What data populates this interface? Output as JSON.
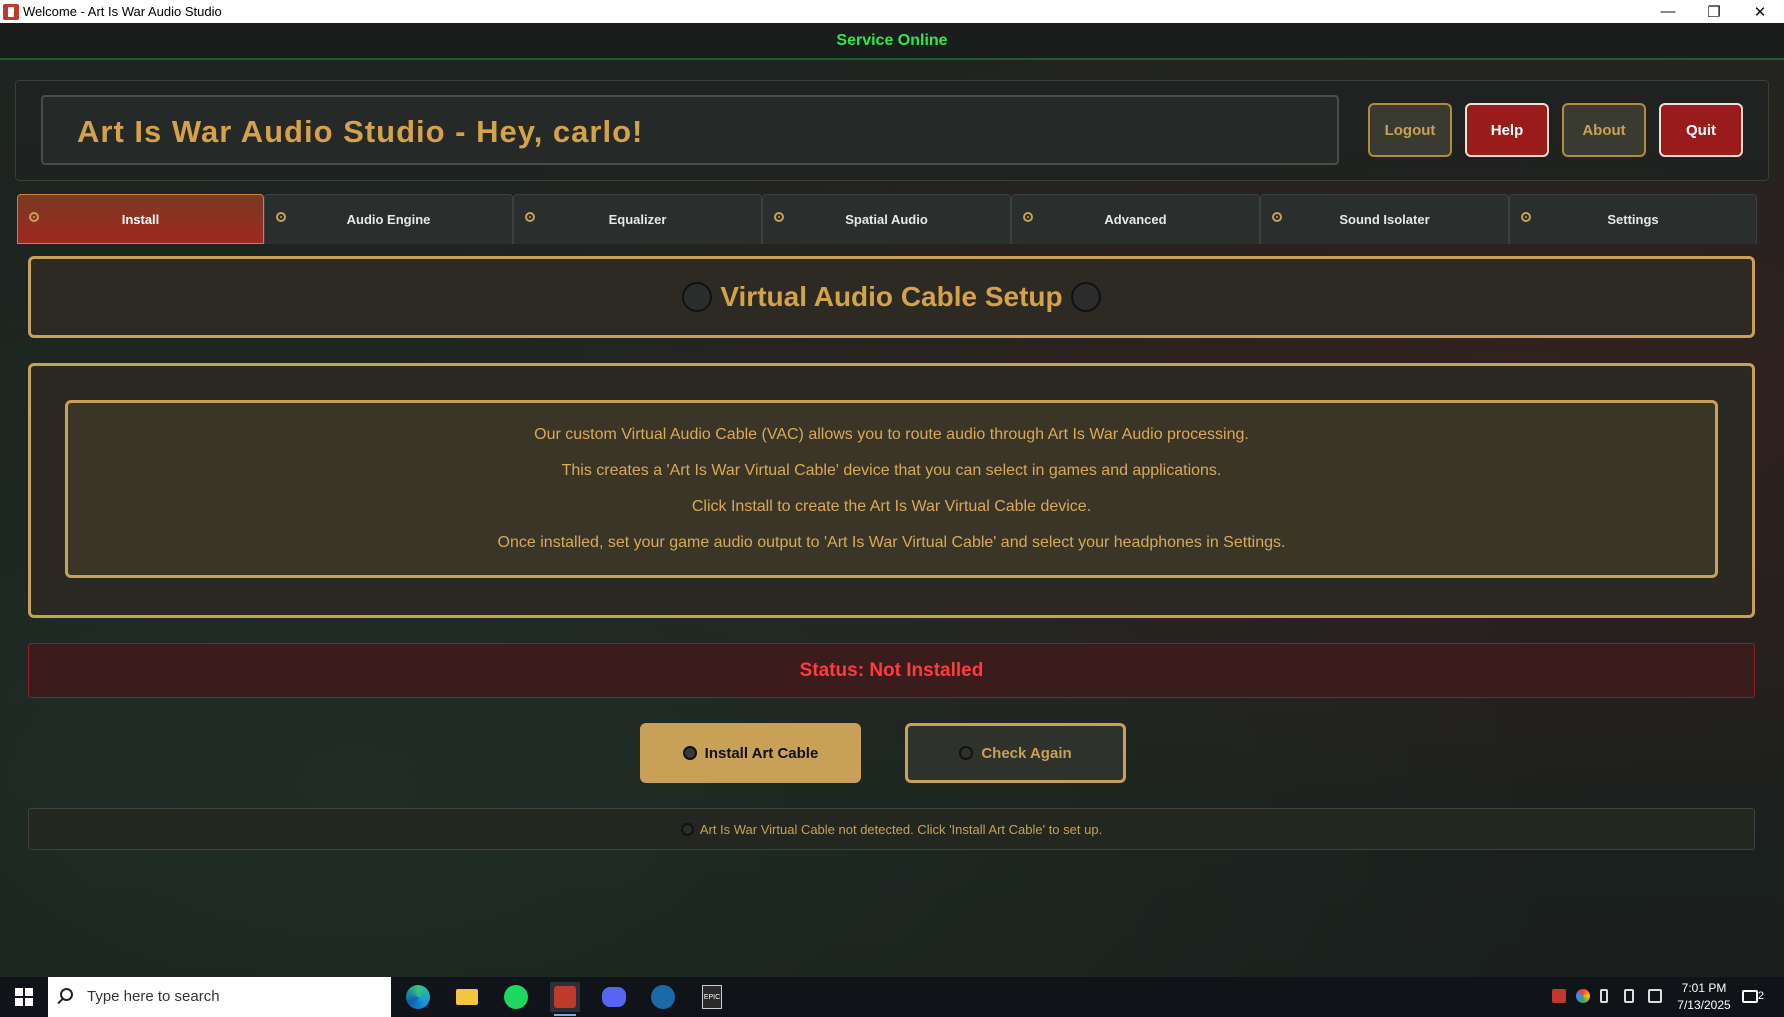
{
  "window": {
    "title": "Welcome - Art Is War Audio Studio",
    "minimize": "—",
    "maximize": "❐",
    "close": "✕"
  },
  "service_status": "Service Online",
  "header": {
    "title": "Art Is War Audio Studio - Hey, carlo!",
    "buttons": {
      "logout": "Logout",
      "help": "Help",
      "about": "About",
      "quit": "Quit"
    }
  },
  "tabs": [
    {
      "label": "Install",
      "active": true
    },
    {
      "label": "Audio Engine",
      "active": false
    },
    {
      "label": "Equalizer",
      "active": false
    },
    {
      "label": "Spatial Audio",
      "active": false
    },
    {
      "label": "Advanced",
      "active": false
    },
    {
      "label": "Sound Isolater",
      "active": false
    },
    {
      "label": "Settings",
      "active": false
    }
  ],
  "section": {
    "title": "Virtual Audio Cable Setup"
  },
  "info_lines": [
    "Our custom Virtual Audio Cable (VAC) allows you to route audio through Art Is War Audio processing.",
    "This creates a 'Art Is War Virtual Cable' device that you can select in games and applications.",
    "Click Install to create the Art Is War Virtual Cable device.",
    "Once installed, set your game audio output to 'Art Is War Virtual Cable' and select your headphones in Settings."
  ],
  "status": "Status: Not Installed",
  "actions": {
    "install": "Install Art Cable",
    "check": "Check Again"
  },
  "note": "Art Is War Virtual Cable not detected. Click 'Install Art Cable' to set up.",
  "taskbar": {
    "search_placeholder": "Type here to search",
    "time": "7:01 PM",
    "date": "7/13/2025",
    "notifications": "2",
    "epic_label": "EPIC"
  },
  "colors": {
    "accent_gold": "#c9a057",
    "danger_red": "#9a1b1b",
    "online_green": "#2ee84a",
    "status_red": "#ff3b3b"
  }
}
